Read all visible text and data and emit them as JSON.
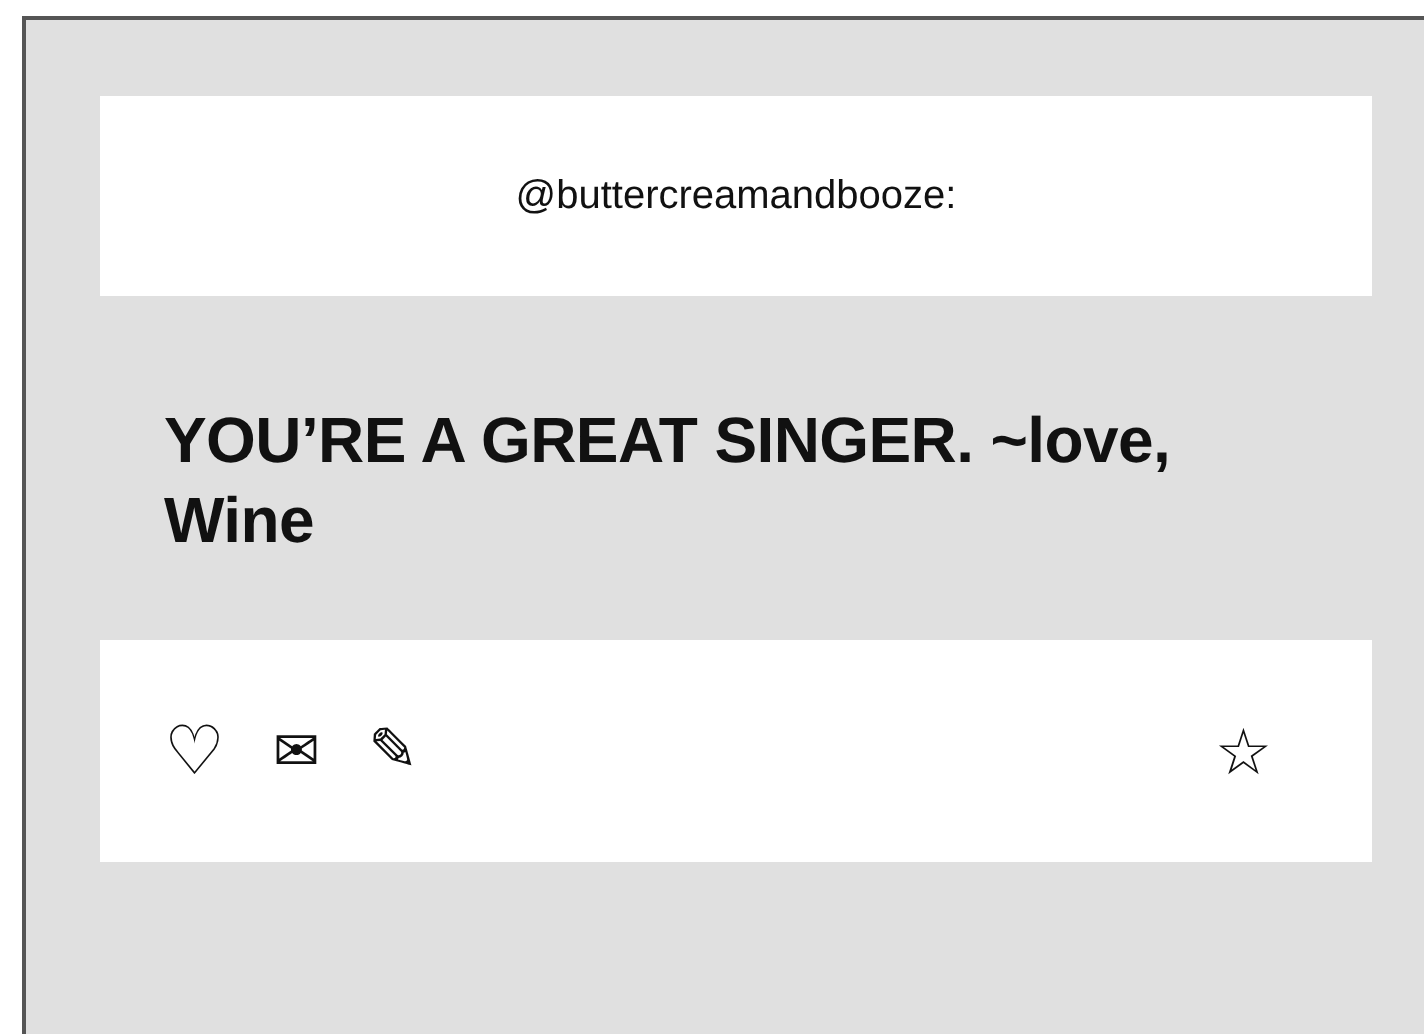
{
  "post": {
    "author": "@buttercreamandbooze:",
    "message": "YOU’RE A GREAT SINGER. ~love, Wine",
    "actions": [
      {
        "kind": "like",
        "glyph": "♡"
      },
      {
        "kind": "message",
        "glyph": "✉"
      },
      {
        "kind": "edit",
        "glyph": "✎"
      }
    ],
    "favorite": {
      "glyph": "☆"
    }
  }
}
